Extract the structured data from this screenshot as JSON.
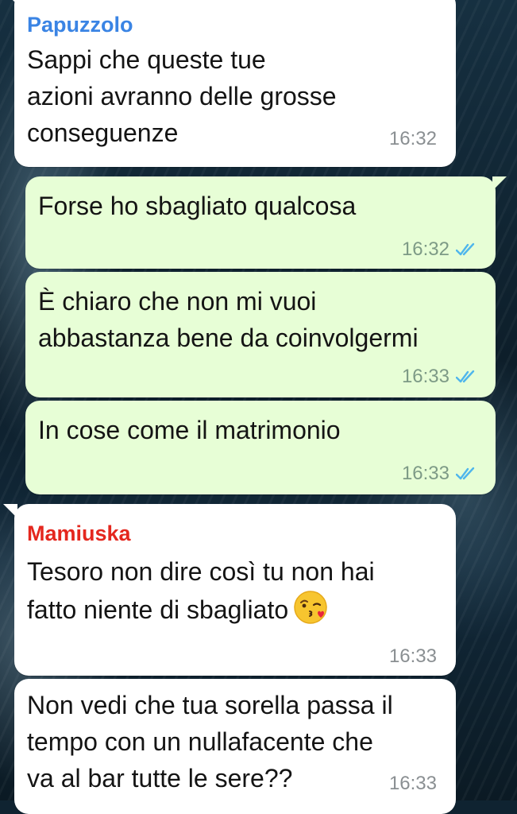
{
  "colors": {
    "incoming_bubble": "#ffffff",
    "outgoing_bubble": "#e7fed6",
    "sender_papuzzolo": "#3a84e4",
    "sender_mamiuska": "#e4271e",
    "read_ticks": "#4fb6ec",
    "wallpaper": "#0f2331"
  },
  "messages": [
    {
      "direction": "incoming",
      "sender": "Papuzzolo",
      "text": "Sappi che queste tue\nazioni avranno delle grosse\nconseguenze",
      "time": "16:32"
    },
    {
      "direction": "outgoing",
      "text": "Forse ho sbagliato qualcosa",
      "time": "16:32",
      "status_icon": "double-check-read-icon"
    },
    {
      "direction": "outgoing",
      "text": "È chiaro che non mi vuoi\nabbastanza bene da coinvolgermi",
      "time": "16:33",
      "status_icon": "double-check-read-icon"
    },
    {
      "direction": "outgoing",
      "text": "In cose come il matrimonio",
      "time": "16:33",
      "status_icon": "double-check-read-icon"
    },
    {
      "direction": "incoming",
      "sender": "Mamiuska",
      "text": "Tesoro non dire così tu non hai\nfatto niente di sbagliato",
      "emoji": "face-blowing-a-kiss-icon",
      "time": "16:33"
    },
    {
      "direction": "incoming",
      "text": "Non vedi che tua sorella passa il\ntempo con un nullafacente che\nva al bar tutte le sere??",
      "time": "16:33"
    }
  ]
}
